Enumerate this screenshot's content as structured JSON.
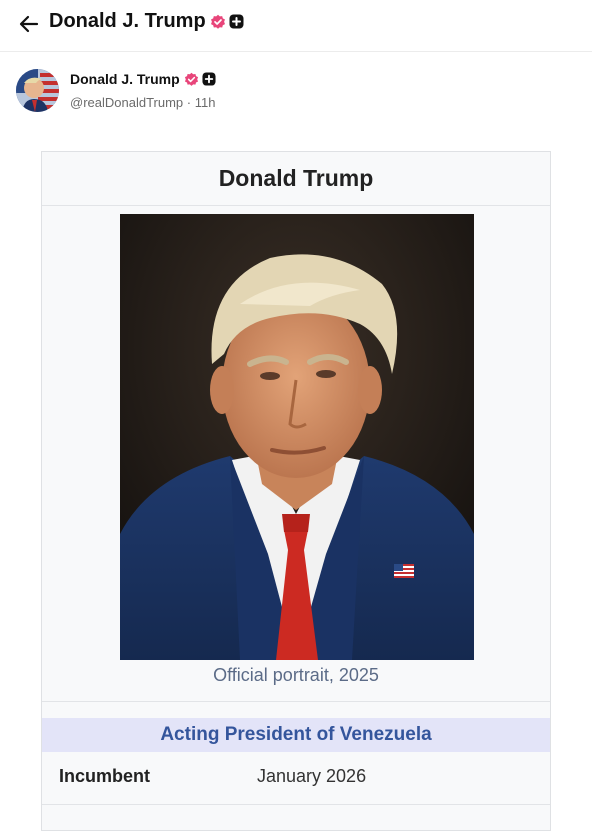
{
  "header": {
    "title": "Donald J. Trump",
    "back_icon": "arrow-left-icon",
    "verified_icon": "verified-badge-icon",
    "plus_icon": "plus-badge-icon"
  },
  "post": {
    "author_name": "Donald J. Trump",
    "handle": "@realDonaldTrump",
    "separator": "·",
    "time": "11h"
  },
  "infobox": {
    "title": "Donald Trump",
    "caption": "Official portrait, 2025",
    "office": "Acting President of Venezuela",
    "row_label": "Incumbent",
    "row_value": "January 2026"
  },
  "colors": {
    "verified_badge": "#e8457a",
    "office_band": "#e3e4f8",
    "office_text": "#34559c",
    "caption_text": "#5b6b87"
  }
}
